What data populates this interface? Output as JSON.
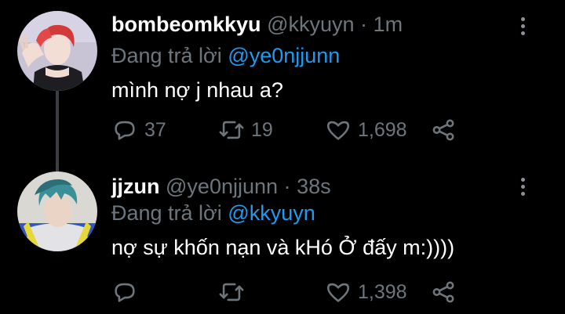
{
  "colors": {
    "background": "#000000",
    "text_primary": "#ffffff",
    "text_secondary": "#6e767d",
    "link": "#1d9bf0",
    "thread_line": "#3b3f44"
  },
  "tweets": [
    {
      "display_name": "bombeomkkyu",
      "handle": "@kkyuyn",
      "separator": "·",
      "time": "1m",
      "reply_prefix": "Đang trả lời",
      "reply_to": "@ye0njjunn",
      "text": "mình nợ j nhau a?",
      "replies": "37",
      "retweets": "19",
      "likes": "1,698",
      "icons": [
        "reply-icon",
        "retweet-icon",
        "like-icon",
        "share-icon",
        "more-icon"
      ]
    },
    {
      "display_name": "jjzun",
      "handle": "@ye0njjunn",
      "separator": "·",
      "time": "38s",
      "reply_prefix": "Đang trả lời",
      "reply_to": "@kkyuyn",
      "text": "nợ sự khốn nạn và kHó Ở đấy m:))))",
      "replies": "",
      "retweets": "",
      "likes": "1,398",
      "icons": [
        "reply-icon",
        "retweet-icon",
        "like-icon",
        "share-icon",
        "more-icon"
      ]
    }
  ]
}
